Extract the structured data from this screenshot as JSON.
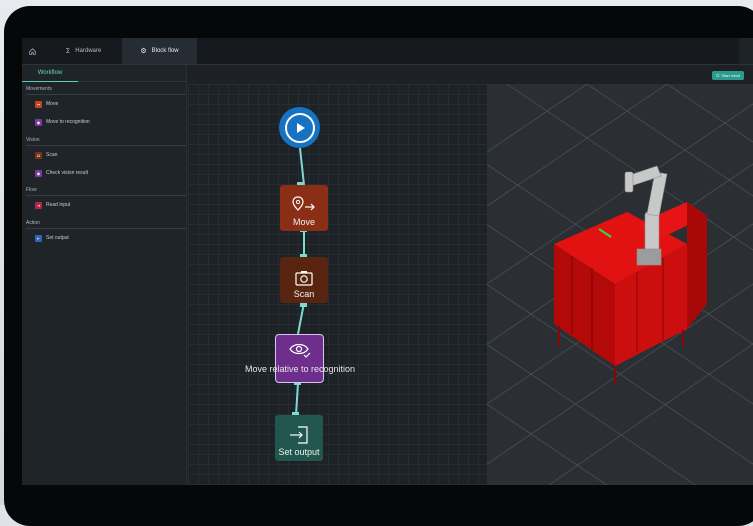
{
  "tabs": [
    {
      "label": "",
      "icon": "home-icon"
    },
    {
      "label": "Hardware",
      "icon": "hardware-icon"
    },
    {
      "label": "Block flow",
      "icon": "gear-icon",
      "active": true
    }
  ],
  "sidebar": {
    "workflow_tab": "Workflow",
    "categories": [
      {
        "label": "Movements",
        "items": [
          {
            "label": "Move",
            "color": "#c2461f",
            "icon": "move-icon"
          },
          {
            "label": "Move to recognition",
            "color": "#7b3a9e",
            "icon": "eye-icon"
          }
        ]
      },
      {
        "label": "Vision",
        "items": [
          {
            "label": "Scan",
            "color": "#7a3316",
            "icon": "camera-icon"
          },
          {
            "label": "Check vision result",
            "color": "#7b3a9e",
            "icon": "eye-icon"
          }
        ]
      },
      {
        "label": "Flow",
        "items": [
          {
            "label": "Read input",
            "color": "#b0294a",
            "icon": "input-icon"
          }
        ]
      },
      {
        "label": "Action",
        "items": [
          {
            "label": "Set output",
            "color": "#2f64b6",
            "icon": "output-icon"
          }
        ]
      }
    ]
  },
  "toolbar": {
    "start_robot": "Start robot"
  },
  "flow": {
    "start_icon": "play-icon",
    "blocks": [
      {
        "label": "Move",
        "icon": "move-icon",
        "color": "#8b2e16"
      },
      {
        "label": "Scan",
        "icon": "camera-icon",
        "color": "#592510"
      },
      {
        "label": "Move relative to recognition",
        "icon": "eye-icon",
        "color": "#6d2e8c"
      },
      {
        "label": "Set output",
        "icon": "output-icon",
        "color": "#21574f"
      }
    ]
  },
  "viewport": {
    "robot_color": "#c8c8c8",
    "cell_color": "#d60c0c",
    "grid_color": "#4a4f55"
  }
}
